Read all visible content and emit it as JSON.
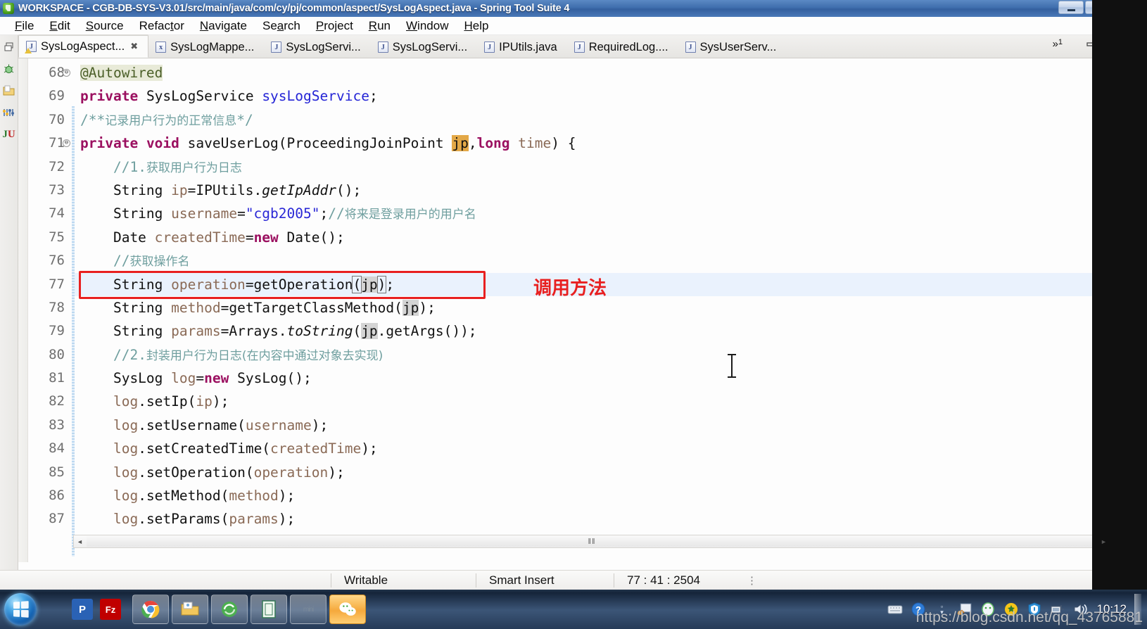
{
  "window": {
    "title": "WORKSPACE - CGB-DB-SYS-V3.01/src/main/java/com/cy/pj/common/aspect/SysLogAspect.java - Spring Tool Suite 4",
    "app_icon": "spring-leaf-icon",
    "controls": {
      "minimize": "minimize-icon",
      "maximize": "maximize-icon",
      "close": "close-icon"
    }
  },
  "menubar": {
    "items": [
      {
        "label": "File",
        "mnemonic": "F"
      },
      {
        "label": "Edit",
        "mnemonic": "E"
      },
      {
        "label": "Source",
        "mnemonic": "S"
      },
      {
        "label": "Refactor",
        "mnemonic": "t"
      },
      {
        "label": "Navigate",
        "mnemonic": "N"
      },
      {
        "label": "Search",
        "mnemonic": "a"
      },
      {
        "label": "Project",
        "mnemonic": "P"
      },
      {
        "label": "Run",
        "mnemonic": "R"
      },
      {
        "label": "Window",
        "mnemonic": "W"
      },
      {
        "label": "Help",
        "mnemonic": "H"
      }
    ]
  },
  "left_rail": {
    "icons": [
      "restore-view-icon",
      "debug-bug-icon",
      "package-explorer-icon",
      "outline-icon",
      "junit-icon"
    ]
  },
  "right_rail": {
    "icons": [
      "restore-view-icon",
      "variables-icon",
      "breakpoints-icon",
      "expressions-icon",
      "minimize-view-icon",
      "console-icon",
      "problems-icon",
      "javadoc-icon",
      "install-icon",
      "spring-boot-dashboard-icon"
    ]
  },
  "tabs": {
    "overflow_label": "»",
    "overflow_count": "1",
    "items": [
      {
        "label": "SysLogAspect...",
        "icon": "java-file-warning-icon",
        "active": true,
        "closeable": true,
        "close_glyph": "✖"
      },
      {
        "label": "SysLogMappe...",
        "icon": "xml-file-icon",
        "active": false,
        "closeable": false
      },
      {
        "label": "SysLogServi...",
        "icon": "java-file-icon",
        "active": false,
        "closeable": false
      },
      {
        "label": "SysLogServi...",
        "icon": "java-file-icon",
        "active": false,
        "closeable": false
      },
      {
        "label": "IPUtils.java",
        "icon": "java-file-icon",
        "active": false,
        "closeable": false
      },
      {
        "label": "RequiredLog....",
        "icon": "java-file-icon",
        "active": false,
        "closeable": false
      },
      {
        "label": "SysUserServ...",
        "icon": "java-file-icon",
        "active": false,
        "closeable": false
      }
    ],
    "window_controls": {
      "minimize": "minimize-editor-icon",
      "maximize": "maximize-editor-icon"
    }
  },
  "editor": {
    "first_line_number": 68,
    "highlighted_line": 77,
    "lines": [
      {
        "num": "68",
        "fold": "⊖",
        "text": "    @Autowired"
      },
      {
        "num": "69",
        "fold": "",
        "text": "    private SysLogService sysLogService;"
      },
      {
        "num": "70",
        "fold": "",
        "text": "    /**记录用户行为的正常信息*/"
      },
      {
        "num": "71",
        "fold": "⊖",
        "text": "    private void saveUserLog(ProceedingJoinPoint jp,long time) {"
      },
      {
        "num": "72",
        "fold": "",
        "text": "        //1.获取用户行为日志"
      },
      {
        "num": "73",
        "fold": "",
        "text": "        String ip=IPUtils.getIpAddr();"
      },
      {
        "num": "74",
        "fold": "",
        "text": "        String username=\"cgb2005\";//将来是登录用户的用户名"
      },
      {
        "num": "75",
        "fold": "",
        "text": "        Date createdTime=new Date();"
      },
      {
        "num": "76",
        "fold": "",
        "text": "        //获取操作名"
      },
      {
        "num": "77",
        "fold": "",
        "text": "        String operation=getOperation(jp);"
      },
      {
        "num": "78",
        "fold": "",
        "text": "        String method=getTargetClassMethod(jp);"
      },
      {
        "num": "79",
        "fold": "",
        "text": "        String params=Arrays.toString(jp.getArgs());"
      },
      {
        "num": "80",
        "fold": "",
        "text": "        //2.封装用户行为日志(在内容中通过对象去实现)"
      },
      {
        "num": "81",
        "fold": "",
        "text": "        SysLog log=new SysLog();"
      },
      {
        "num": "82",
        "fold": "",
        "text": "        log.setIp(ip);"
      },
      {
        "num": "83",
        "fold": "",
        "text": "        log.setUsername(username);"
      },
      {
        "num": "84",
        "fold": "",
        "text": "        log.setCreatedTime(createdTime);"
      },
      {
        "num": "85",
        "fold": "",
        "text": "        log.setOperation(operation);"
      },
      {
        "num": "86",
        "fold": "",
        "text": "        log.setMethod(method);"
      },
      {
        "num": "87",
        "fold": "",
        "text": "        log.setParams(params);"
      }
    ],
    "annotation": {
      "note_text": "调用方法",
      "note_color": "#e82020",
      "box_target_line": "77"
    },
    "colors": {
      "keyword": "#9b1060",
      "field": "#2424d6",
      "local_variable": "#8a6a56",
      "string": "#2a27d6",
      "comment": "#6f9f9f",
      "annotation_bg": "#e8ead8",
      "occurrence_bg": "#e3a847",
      "current_line_bg": "#eaf2fd"
    }
  },
  "scrollbars": {
    "vertical_up": "▲",
    "vertical_down": "▼",
    "horizontal_left": "◄",
    "horizontal_right": "►",
    "horizontal_grip": "‖‖"
  },
  "statusbar": {
    "writable": "Writable",
    "insert_mode": "Smart Insert",
    "position": "77 : 41 : 2504",
    "more_glyph": "⋮"
  },
  "taskbar": {
    "start_button": "windows-start-orb",
    "quick_launch": [
      {
        "name": "pdf-reader-icon",
        "glyph": "P",
        "color": "#2a62b5"
      },
      {
        "name": "filezilla-icon",
        "glyph": "Fz",
        "color": "#c00000"
      }
    ],
    "buttons": [
      {
        "name": "chrome-icon",
        "active": false
      },
      {
        "name": "file-explorer-icon",
        "active": false
      },
      {
        "name": "sogou-browser-icon",
        "active": false
      },
      {
        "name": "notes-app-icon",
        "active": false
      },
      {
        "name": "text-app-icon",
        "active": false
      },
      {
        "name": "wechat-icon",
        "active": true
      }
    ],
    "tray": [
      {
        "name": "keyboard-icon",
        "glyph": "⌨"
      },
      {
        "name": "help-icon",
        "glyph": "?"
      },
      {
        "name": "show-hidden-icon",
        "glyph": "▾"
      },
      {
        "name": "screenshot-icon",
        "glyph": "⬚"
      },
      {
        "name": "qq-icon",
        "glyph": "●"
      },
      {
        "name": "sogou-pinyin-icon",
        "glyph": "✦"
      },
      {
        "name": "antivirus-shield-icon",
        "glyph": "▼"
      },
      {
        "name": "network-icon",
        "glyph": "▣"
      },
      {
        "name": "volume-icon",
        "glyph": "🔊"
      }
    ],
    "clock": "10:12",
    "show_desktop": "show-desktop-button"
  },
  "watermark": {
    "text": "https://blog.csdn.net/qq_43765881"
  }
}
